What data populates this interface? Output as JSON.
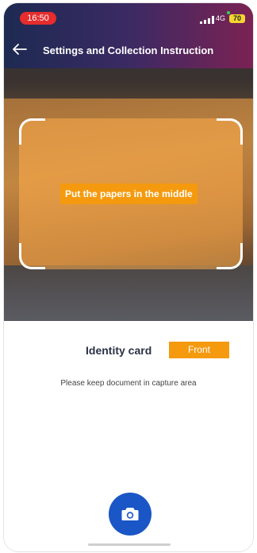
{
  "status_bar": {
    "time": "16:50",
    "network": "4G",
    "battery": "70"
  },
  "header": {
    "title": "Settings and Collection Instruction"
  },
  "camera": {
    "hint": "Put the papers in the middle"
  },
  "panel": {
    "document_type": "Identity card",
    "side": "Front",
    "instruction": "Please keep document in capture area"
  },
  "icons": {
    "back": "arrow-left-icon",
    "capture": "camera-icon",
    "signal": "signal-icon"
  },
  "colors": {
    "accent": "#f59a0f",
    "capture_button": "#1a56c6",
    "time_pill": "#e52d2d"
  }
}
